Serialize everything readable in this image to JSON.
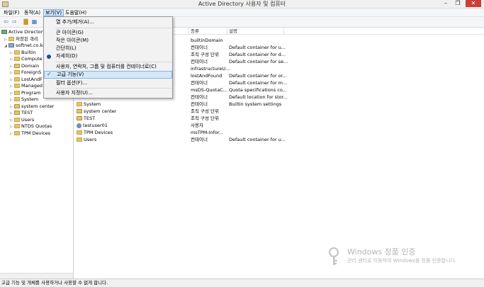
{
  "window": {
    "title": "Active Directory 사용자 및 컴퓨터",
    "minimize": "–",
    "maximize": "❐",
    "close": "✕"
  },
  "menubar": {
    "items": [
      "파일(F)",
      "동작(A)",
      "보기(V)",
      "도움말(H)"
    ]
  },
  "tree": {
    "root": "Active Directory",
    "saved_queries": "저장된 쿼리",
    "domain": "softnet.co.kr",
    "children": [
      "Builtin",
      "Compute",
      "Domain",
      "ForeignS",
      "LostAndF",
      "Managed",
      "Program",
      "System",
      "system center",
      "TEST",
      "Users",
      "NTDS Quotas",
      "TPM Devices"
    ]
  },
  "columns": {
    "type": "종류",
    "description": "설명"
  },
  "top_rows": [
    {
      "type": "builtinDomain",
      "desc": ""
    },
    {
      "type": "컨테이너",
      "desc": "Default container for u..."
    },
    {
      "type": "조직 구성 단위",
      "desc": "Default container for d..."
    },
    {
      "type": "컨테이너",
      "desc": "Default container for se..."
    },
    {
      "type": "infrastructureU...",
      "desc": ""
    },
    {
      "type": "lostAndFound",
      "desc": "Default container for or..."
    },
    {
      "type": "컨테이너",
      "desc": "Default container for m..."
    },
    {
      "type": "msDS-QuotaC...",
      "desc": "Quota specifications co..."
    },
    {
      "type": "컨테이너",
      "desc": "Default location for stor..."
    }
  ],
  "rows": [
    {
      "name": "System",
      "type": "컨테이너",
      "desc": "Builtin system settings",
      "icon": "folder-icon"
    },
    {
      "name": "system center",
      "type": "조직 구성 단위",
      "desc": "",
      "icon": "ou-icon"
    },
    {
      "name": "TEST",
      "type": "조직 구성 단위",
      "desc": "",
      "icon": "ou-icon"
    },
    {
      "name": "testuser01",
      "type": "사용자",
      "desc": "",
      "icon": "user-icon"
    },
    {
      "name": "TPM Devices",
      "type": "msTPM-Infor...",
      "desc": "",
      "icon": "folder-icon"
    },
    {
      "name": "Users",
      "type": "컨테이너",
      "desc": "Default container for u...",
      "icon": "folder-icon"
    }
  ],
  "view_menu": {
    "add_remove_columns": "열 추가/제거(A)...",
    "large_icons": "큰 아이콘(G)",
    "small_icons": "작은 아이콘(M)",
    "list": "간단히(L)",
    "detail": "자세히(D)",
    "users_groups_computers": "사용자, 연락처, 그룹 및 컴퓨터를 컨테이너로(C)",
    "advanced_features": "고급 기능(V)",
    "filter_options": "필터 옵션(F)...",
    "customize": "사용자 지정(U)..."
  },
  "watermark": {
    "title": "Windows 정품 인증",
    "subtitle": "관리 센터로 이동하여 Windows를 정품 인증합니다."
  },
  "status": "고급 기능 및 개체를 사용하거나 사용할 수 없게 합니다."
}
